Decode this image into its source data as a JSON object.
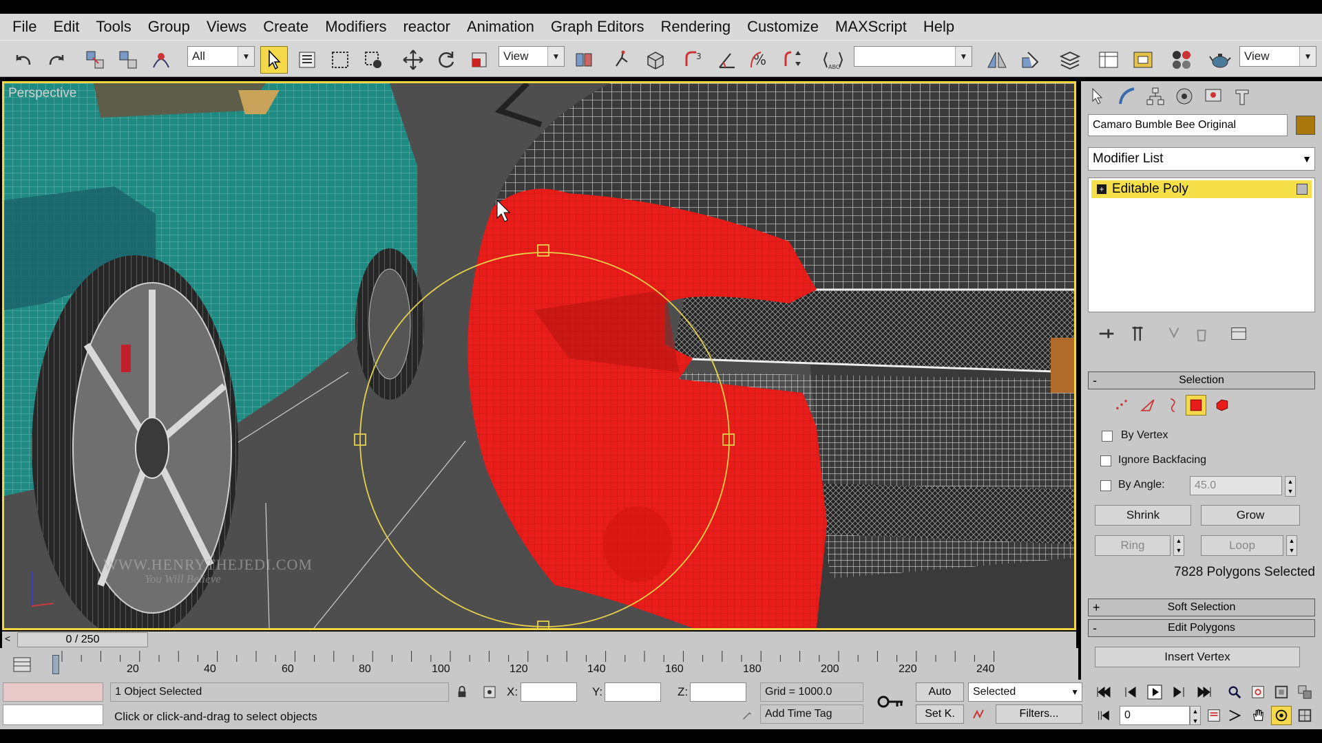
{
  "menu": [
    "File",
    "Edit",
    "Tools",
    "Group",
    "Views",
    "Create",
    "Modifiers",
    "reactor",
    "Animation",
    "Graph Editors",
    "Rendering",
    "Customize",
    "MAXScript",
    "Help"
  ],
  "toolbar": {
    "selection_filter": "All",
    "ref_coord": "View",
    "named_selection": "",
    "render_view": "View"
  },
  "viewport": {
    "label": "Perspective",
    "watermark": "WWW.HENRYTHEJEDI.COM",
    "watermark_tag": "You Will Believe"
  },
  "command_panel": {
    "object_name": "Camaro Bumble Bee Original",
    "object_color": "#a8780b",
    "modifier_list": "Modifier List",
    "stack_item": "Editable Poly",
    "selection_rollout": "Selection",
    "by_vertex": "By Vertex",
    "ignore_backfacing": "Ignore Backfacing",
    "by_angle": "By Angle:",
    "angle_value": "45.0",
    "shrink": "Shrink",
    "grow": "Grow",
    "ring": "Ring",
    "loop": "Loop",
    "selection_count": "7828 Polygons Selected",
    "soft_selection": "Soft Selection",
    "edit_polygons": "Edit Polygons",
    "insert_vertex": "Insert Vertex"
  },
  "timeline": {
    "frame": "0 / 250",
    "ticks": [
      "20",
      "40",
      "60",
      "80",
      "100",
      "120",
      "140",
      "160",
      "180",
      "200",
      "220",
      "240"
    ]
  },
  "status": {
    "selected_count": "1 Object Selected",
    "prompt": "Click or click-and-drag to select objects",
    "x_label": "X:",
    "y_label": "Y:",
    "z_label": "Z:",
    "grid": "Grid = 1000.0",
    "add_time_tag": "Add Time Tag",
    "auto_key": "Auto",
    "set_key": "Set K.",
    "key_filter": "Selected",
    "filters": "Filters...",
    "current_frame": "0"
  },
  "colors": {
    "accent": "#f2d641",
    "selection_red": "#e8201a",
    "teal_car": "#1f8f86"
  }
}
